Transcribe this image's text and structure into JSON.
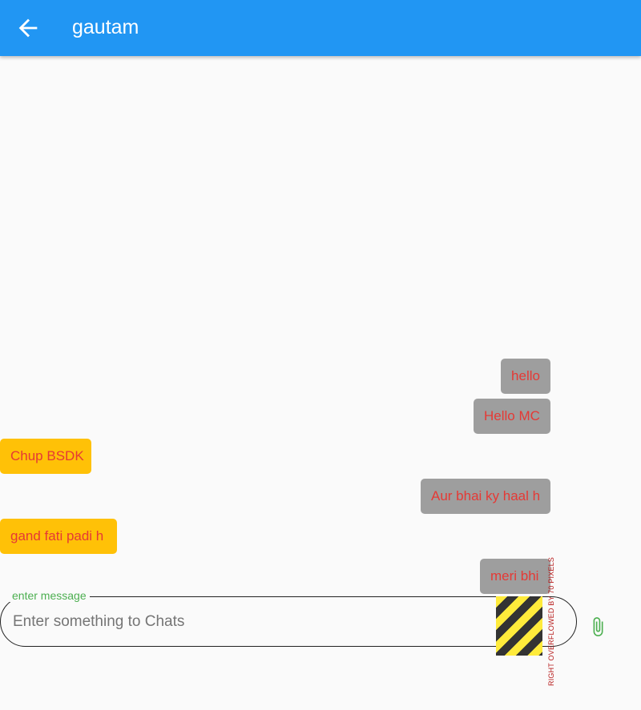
{
  "appbar": {
    "title": "gautam",
    "back_icon": "arrow-back-icon",
    "color": "#2196f3"
  },
  "messages": [
    {
      "text": "hello",
      "side": "sent"
    },
    {
      "text": "Hello MC",
      "side": "sent"
    },
    {
      "text": "Chup BSDK",
      "side": "received"
    },
    {
      "text": "Aur bhai ky haal h",
      "side": "sent"
    },
    {
      "text": "gand fati padi h",
      "side": "received"
    },
    {
      "text": "meri bhi",
      "side": "sent"
    }
  ],
  "composer": {
    "label": "enter message",
    "placeholder": "Enter something to Chats",
    "value": "",
    "attach_icon": "paperclip-icon",
    "overflow_warning": "RIGHT OVERFLOWED BY 70 PIXELS"
  },
  "colors": {
    "sent_bubble": "#9e9e9e",
    "received_bubble": "#ffc107",
    "message_text": "#e53935",
    "label": "#4caf50"
  }
}
